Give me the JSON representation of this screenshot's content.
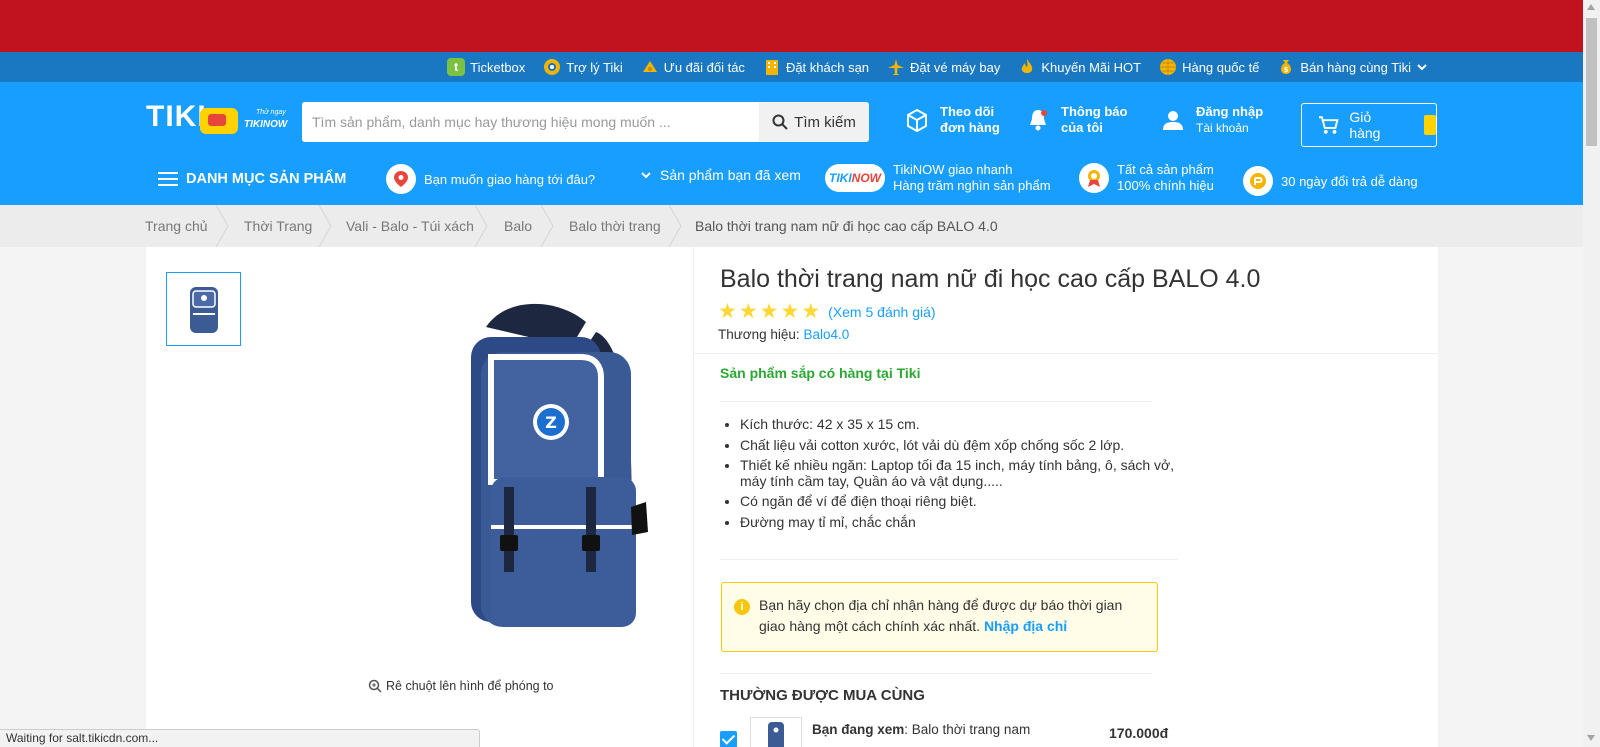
{
  "colors": {
    "banner": "#c1121f",
    "top_links_bg": "#1a78c2",
    "header_bg": "#189eff",
    "accent": "#189eff",
    "stock_green": "#2ba832",
    "star": "#fdd835",
    "notice_border": "#f5c60a"
  },
  "top_links": [
    {
      "label": "Ticketbox",
      "icon": "ticketbox-icon"
    },
    {
      "label": "Trợ lý Tiki",
      "icon": "assistant-icon"
    },
    {
      "label": "Ưu đãi đối tác",
      "icon": "partner-offer-icon"
    },
    {
      "label": "Đặt khách sạn",
      "icon": "hotel-icon"
    },
    {
      "label": "Đặt vé máy bay",
      "icon": "airplane-icon"
    },
    {
      "label": "Khuyến Mãi HOT",
      "icon": "fire-icon"
    },
    {
      "label": "Hàng quốc tế",
      "icon": "globe-icon"
    },
    {
      "label": "Bán hàng cùng Tiki",
      "icon": "money-bag-icon"
    }
  ],
  "header": {
    "logo": "TIKI",
    "logo_sub1": "Thử ngay",
    "logo_sub2": "TIKINOW",
    "search_placeholder": "Tìm sản phẩm, danh mục hay thương hiệu mong muốn ...",
    "search_button": "Tìm kiếm",
    "track_line1": "Theo dõi",
    "track_line2": "đơn hàng",
    "notify_line1": "Thông báo",
    "notify_line2": "của tôi",
    "login_line1": "Đăng nhập",
    "login_line2": "Tài khoản",
    "cart_label": "Giỏ hàng"
  },
  "subnav": {
    "categories": "DANH MỤC SẢN PHẨM",
    "delivery": "Bạn muốn giao hàng tới đâu?",
    "viewed": "Sản phẩm bạn đã xem",
    "tikinow_badge_a": "TIKI",
    "tikinow_badge_b": "NOW",
    "tikinow_line1": "TikiNOW giao nhanh",
    "tikinow_line2": "Hàng trăm nghìn sản phẩm",
    "genuine_line1": "Tất cả sản phẩm",
    "genuine_line2": "100% chính hiệu",
    "return": "30 ngày đổi trả dễ dàng"
  },
  "breadcrumb": [
    "Trang chủ",
    "Thời Trang",
    "Vali - Balo - Túi xách",
    "Balo",
    "Balo thời trang"
  ],
  "breadcrumb_current": "Balo thời trang nam nữ đi học cao cấp BALO 4.0",
  "product": {
    "title": "Balo thời trang nam nữ đi học cao cấp BALO 4.0",
    "rating": 5,
    "reviews_link": "(Xem 5 đánh giá)",
    "brand_label": "Thương hiệu:",
    "brand": "Balo4.0",
    "stock_status": "Sản phẩm sắp có hàng tại Tiki",
    "zoom_hint": "Rê chuột lên hình để phóng to",
    "bag_logo": "Z",
    "features": [
      "Kích thước: 42 x 35 x 15 cm.",
      "Chất liệu vải cotton xước, lót vải dù đệm xốp chống sốc 2 lớp.",
      "Thiết kế nhiều ngăn: Laptop tối đa 15 inch, máy tính bảng, ô, sách vở, máy tính cầm tay, Quần áo và vật dụng.....",
      "Có ngăn để ví để điện thoại riêng biệt.",
      "Đường may tỉ mỉ, chắc chắn"
    ],
    "notice_text": "Bạn hãy chọn địa chỉ nhận hàng để được dự báo thời gian giao hàng một cách chính xác nhất.",
    "notice_link": "Nhập địa chỉ"
  },
  "bought_together": {
    "title": "THƯỜNG ĐƯỢC MUA CÙNG",
    "viewing_label": "Bạn đang xem",
    "viewing_name": ": Balo thời trang nam",
    "price": "170.000đ"
  },
  "status_bar": "Waiting for salt.tikicdn.com..."
}
